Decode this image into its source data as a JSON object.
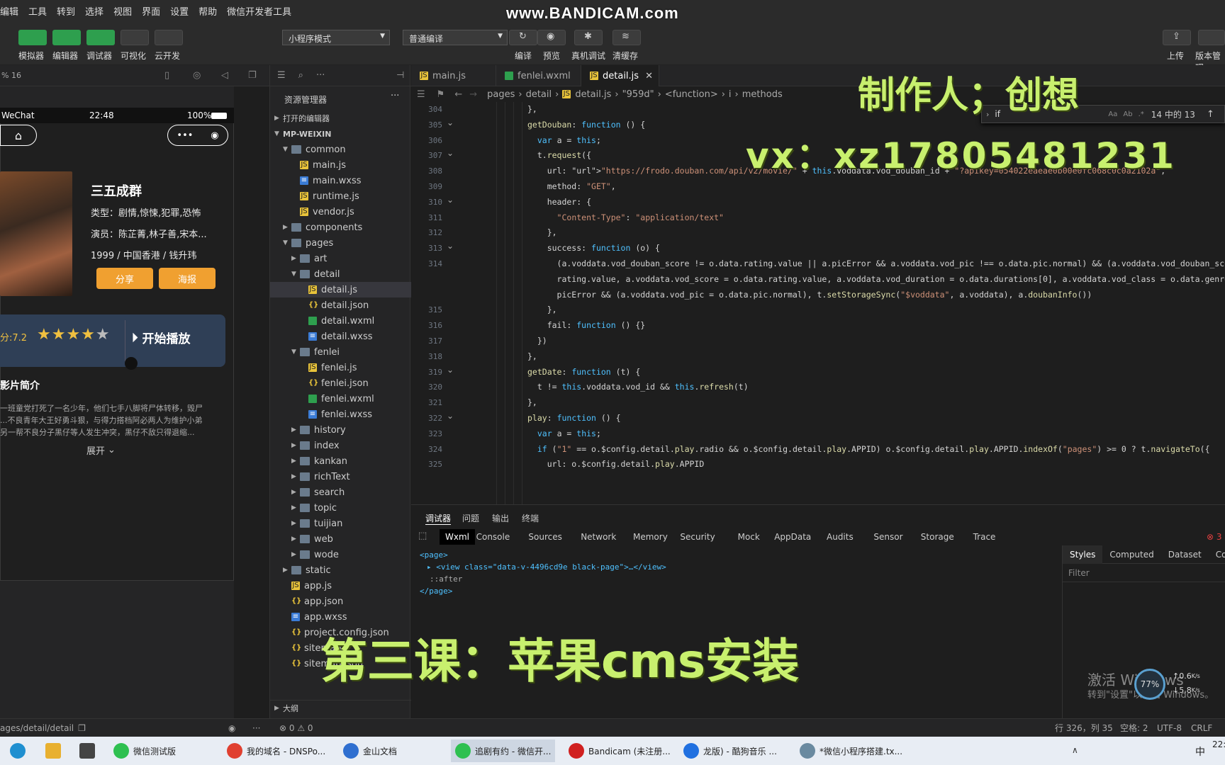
{
  "menu": {
    "items": [
      "编辑",
      "工具",
      "转到",
      "选择",
      "视图",
      "界面",
      "设置",
      "帮助",
      "微信开发者工具"
    ]
  },
  "watermark": "www.BANDICAM.com",
  "toolbar": {
    "left_buttons": [
      "模拟器",
      "编辑器",
      "调试器",
      "可视化",
      "云开发"
    ],
    "mode_select": "小程序模式",
    "compile_select": "普通编译",
    "center_buttons": [
      "编译",
      "预览",
      "真机调试",
      "清缓存"
    ],
    "right_buttons": [
      "上传",
      "版本管理"
    ]
  },
  "simulator": {
    "zoom": "% 16",
    "status_wechat": "WeChat",
    "status_time": "22:48",
    "status_battery": "100%",
    "movie": {
      "title": "三五成群",
      "type": "类型：剧情,惊悚,犯罪,恐怖",
      "actors": "演员：陈芷菁,林子善,宋本...",
      "meta": "1999 / 中国香港 / 钱升玮",
      "share": "分享",
      "poster": "海报",
      "score": "分:7.2",
      "play": "开始播放",
      "intro_title": "影片简介",
      "intro_text_1": "一班童党打死了一名少年，他们七手八脚将尸体转移，毁尸",
      "intro_text_2": "...不良青年大王好勇斗狠，与得力搭档阿必两人为维护小弟",
      "intro_text_3": "另一帮不良分子黑仔等人发生冲突，黑仔不敌只得退缩...",
      "expand": "展开"
    },
    "path": "ages/detail/detail"
  },
  "explorer": {
    "title": "资源管理器",
    "open_editors": "打开的编辑器",
    "project": "MP-WEIXIN",
    "items": [
      {
        "name": "common",
        "type": "folder",
        "indent": 1,
        "open": true
      },
      {
        "name": "main.js",
        "type": "js",
        "indent": 2
      },
      {
        "name": "main.wxss",
        "type": "wxss",
        "indent": 2
      },
      {
        "name": "runtime.js",
        "type": "js",
        "indent": 2
      },
      {
        "name": "vendor.js",
        "type": "js",
        "indent": 2
      },
      {
        "name": "components",
        "type": "folder",
        "indent": 1,
        "open": false
      },
      {
        "name": "pages",
        "type": "folder",
        "indent": 1,
        "open": true
      },
      {
        "name": "art",
        "type": "folder",
        "indent": 2,
        "open": false
      },
      {
        "name": "detail",
        "type": "folder",
        "indent": 2,
        "open": true
      },
      {
        "name": "detail.js",
        "type": "js",
        "indent": 3,
        "selected": true
      },
      {
        "name": "detail.json",
        "type": "json",
        "indent": 3
      },
      {
        "name": "detail.wxml",
        "type": "wxml",
        "indent": 3
      },
      {
        "name": "detail.wxss",
        "type": "wxss",
        "indent": 3
      },
      {
        "name": "fenlei",
        "type": "folder",
        "indent": 2,
        "open": true
      },
      {
        "name": "fenlei.js",
        "type": "js",
        "indent": 3
      },
      {
        "name": "fenlei.json",
        "type": "json",
        "indent": 3
      },
      {
        "name": "fenlei.wxml",
        "type": "wxml",
        "indent": 3
      },
      {
        "name": "fenlei.wxss",
        "type": "wxss",
        "indent": 3
      },
      {
        "name": "history",
        "type": "folder",
        "indent": 2,
        "open": false
      },
      {
        "name": "index",
        "type": "folder",
        "indent": 2,
        "open": false
      },
      {
        "name": "kankan",
        "type": "folder",
        "indent": 2,
        "open": false
      },
      {
        "name": "richText",
        "type": "folder",
        "indent": 2,
        "open": false
      },
      {
        "name": "search",
        "type": "folder",
        "indent": 2,
        "open": false
      },
      {
        "name": "topic",
        "type": "folder",
        "indent": 2,
        "open": false
      },
      {
        "name": "tuijian",
        "type": "folder",
        "indent": 2,
        "open": false
      },
      {
        "name": "web",
        "type": "folder",
        "indent": 2,
        "open": false
      },
      {
        "name": "wode",
        "type": "folder",
        "indent": 2,
        "open": false
      },
      {
        "name": "static",
        "type": "folder",
        "indent": 1,
        "open": false
      },
      {
        "name": "app.js",
        "type": "js",
        "indent": 1
      },
      {
        "name": "app.json",
        "type": "json",
        "indent": 1
      },
      {
        "name": "app.wxss",
        "type": "wxss",
        "indent": 1
      },
      {
        "name": "project.config.json",
        "type": "json",
        "indent": 1
      },
      {
        "name": "sitemap",
        "type": "json",
        "indent": 1
      },
      {
        "name": "sitemap.json",
        "type": "json",
        "indent": 1
      }
    ],
    "outline": "大纲"
  },
  "editor": {
    "tabs": [
      "main.js",
      "fenlei.wxml",
      "detail.js"
    ],
    "breadcrumb": [
      "pages",
      "detail",
      "detail.js",
      "\"959d\"",
      "<function>",
      "i",
      "methods"
    ],
    "find": {
      "query": "if",
      "count": "14 中的 13"
    },
    "lines": [
      {
        "n": "304",
        "t": "},"
      },
      {
        "n": "305",
        "t": "getDouban: function () {"
      },
      {
        "n": "306",
        "t": "  var a = this;"
      },
      {
        "n": "307",
        "t": "  t.request({"
      },
      {
        "n": "308",
        "t": "    url: \"https://frodo.douban.com/api/v2/movie/\" + this.voddata.vod_douban_id + \"?apikey=054022eaeae0b00e0fc068c0c0a2102a\","
      },
      {
        "n": "309",
        "t": "    method: \"GET\","
      },
      {
        "n": "310",
        "t": "    header: {"
      },
      {
        "n": "311",
        "t": "      \"Content-Type\": \"application/text\""
      },
      {
        "n": "312",
        "t": "    },"
      },
      {
        "n": "313",
        "t": "    success: function (o) {"
      },
      {
        "n": "314",
        "t": "      (a.voddata.vod_douban_score != o.data.rating.value || a.picError && a.voddata.vod_pic !== o.data.pic.normal) && (a.voddata.vod_douban_score = o."
      },
      {
        "n": "",
        "t": "      rating.value, a.voddata.vod_score = o.data.rating.value, a.voddata.vod_duration = o.data.durations[0], a.voddata.vod_class = o.data.genres.join"
      },
      {
        "n": "",
        "t": "      picError && (a.voddata.vod_pic = o.data.pic.normal), t.setStorageSync(\"$voddata\", a.voddata), a.doubanInfo())"
      },
      {
        "n": "315",
        "t": "    },"
      },
      {
        "n": "316",
        "t": "    fail: function () {}"
      },
      {
        "n": "317",
        "t": "  })"
      },
      {
        "n": "318",
        "t": "},"
      },
      {
        "n": "319",
        "t": "getDate: function (t) {"
      },
      {
        "n": "320",
        "t": "  t != this.voddata.vod_id && this.refresh(t)"
      },
      {
        "n": "321",
        "t": "},"
      },
      {
        "n": "322",
        "t": "play: function () {"
      },
      {
        "n": "323",
        "t": "  var a = this;"
      },
      {
        "n": "324",
        "t": "  if (\"1\" == o.$config.detail.play.radio && o.$config.detail.play.APPID) o.$config.detail.play.APPID.indexOf(\"pages\") >= 0 ? t.navigateTo({"
      },
      {
        "n": "325",
        "t": "    url: o.$config.detail.play.APPID"
      }
    ]
  },
  "devtools": {
    "top_tabs": [
      "调试器",
      "问题",
      "输出",
      "终端"
    ],
    "tabs": [
      "Wxml",
      "Console",
      "Sources",
      "Network",
      "Memory",
      "Security",
      "Mock",
      "AppData",
      "Audits",
      "Sensor",
      "Storage",
      "Trace"
    ],
    "error_count": "3",
    "dom": [
      "<page>",
      "<view class=\"data-v-4496cd9e black-page\">…</view>",
      "::after",
      "</page>"
    ],
    "styles_tabs": [
      "Styles",
      "Computed",
      "Dataset",
      "Compo"
    ],
    "filter": "Filter"
  },
  "overlay": {
    "maker": "制作人；创想",
    "vx": "vx：xz17805481231",
    "lesson": "第三课：苹果cms安装",
    "activate_1": "激活 Windows",
    "activate_2": "转到\"设置\"以激活 Windows。",
    "net_up": "0.6",
    "net_down": "5.8",
    "net_unit": "K/s",
    "cpu": "77%"
  },
  "status": {
    "problems": "⊗ 0 ⚠ 0",
    "position": "行 326，列 35",
    "spaces": "空格: 2",
    "encoding": "UTF-8",
    "eol": "CRLF"
  },
  "taskbar": {
    "apps": [
      "微信测试版",
      "我的域名 - DNSPo...",
      "金山文档",
      "追剧有约 - 微信开...",
      "Bandicam (未注册...",
      "龙版) - 酷狗音乐 ...",
      "*微信小程序搭建.tx..."
    ],
    "lang": "中",
    "clock": "22:"
  },
  "colors": {
    "accent_green": "#2e9f4e",
    "overlay_text": "#c8f06e",
    "orange": "#f0a030"
  }
}
